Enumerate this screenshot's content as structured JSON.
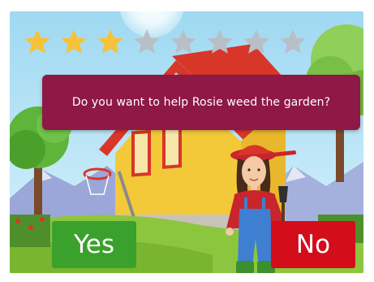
{
  "game": {
    "question": "Do you want to help Rosie weed the garden?",
    "yes_label": "Yes",
    "no_label": "No"
  },
  "progress": {
    "stars_earned": 3,
    "stars_total": 8
  },
  "colors": {
    "prompt_bg": "#8e1846",
    "yes_bg": "#3aa12c",
    "no_bg": "#d40d1a",
    "star_filled": "#f5c23a",
    "star_empty": "#b9bfc6",
    "sky": "#bfe6f7",
    "grass": "#8cc63f"
  },
  "icons": {
    "star": "star-icon",
    "character": "rosie-character"
  }
}
